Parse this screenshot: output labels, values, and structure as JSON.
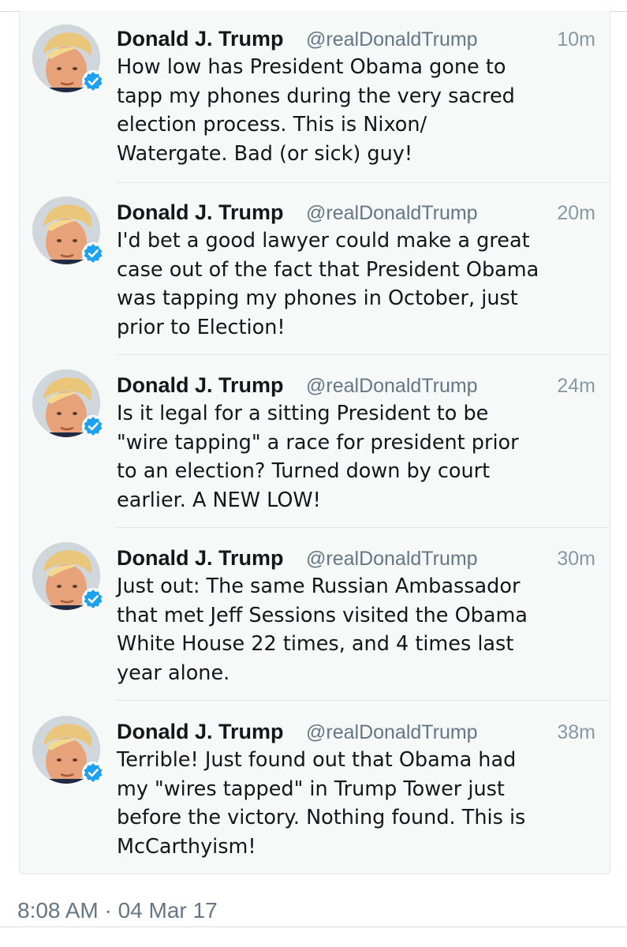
{
  "tweets": [
    {
      "name": "Donald J. Trump",
      "handle": "@realDonaldTrump",
      "time": "10m",
      "lines": [
        "How low has President Obama gone to",
        "tapp my phones during the very sacred",
        "election process. This is Nixon/",
        "Watergate. Bad (or sick) guy!"
      ]
    },
    {
      "name": "Donald J. Trump",
      "handle": "@realDonaldTrump",
      "time": "20m",
      "lines": [
        "I'd bet a good lawyer could make a great",
        "case out of the fact that President Obama",
        "was tapping my phones in October, just",
        "prior to Election!"
      ]
    },
    {
      "name": "Donald J. Trump",
      "handle": "@realDonaldTrump",
      "time": "24m",
      "lines": [
        "Is it legal for a sitting President to be",
        "\"wire tapping\" a race for president prior",
        "to an election? Turned down by court",
        "earlier. A NEW LOW!"
      ]
    },
    {
      "name": "Donald J. Trump",
      "handle": "@realDonaldTrump",
      "time": "30m",
      "lines": [
        "Just out: The same Russian Ambassador",
        "that met Jeff Sessions visited the Obama",
        "White House 22 times, and 4 times last",
        "year alone."
      ]
    },
    {
      "name": "Donald J. Trump",
      "handle": "@realDonaldTrump",
      "time": "38m",
      "lines": [
        "Terrible! Just found out that Obama had",
        "my \"wires tapped\" in Trump Tower just",
        "before the victory. Nothing found. This is",
        "McCarthyism!"
      ]
    }
  ],
  "footer": {
    "timestamp": "8:08 AM · 04 Mar 17"
  },
  "icons": {
    "avatar": "profile-photo",
    "verified": "verified-badge-icon"
  },
  "colors": {
    "verified_blue": "#1da1f2",
    "card_background": "#f7f8f8",
    "secondary_text": "#657786",
    "divider": "#e1e8ed"
  }
}
